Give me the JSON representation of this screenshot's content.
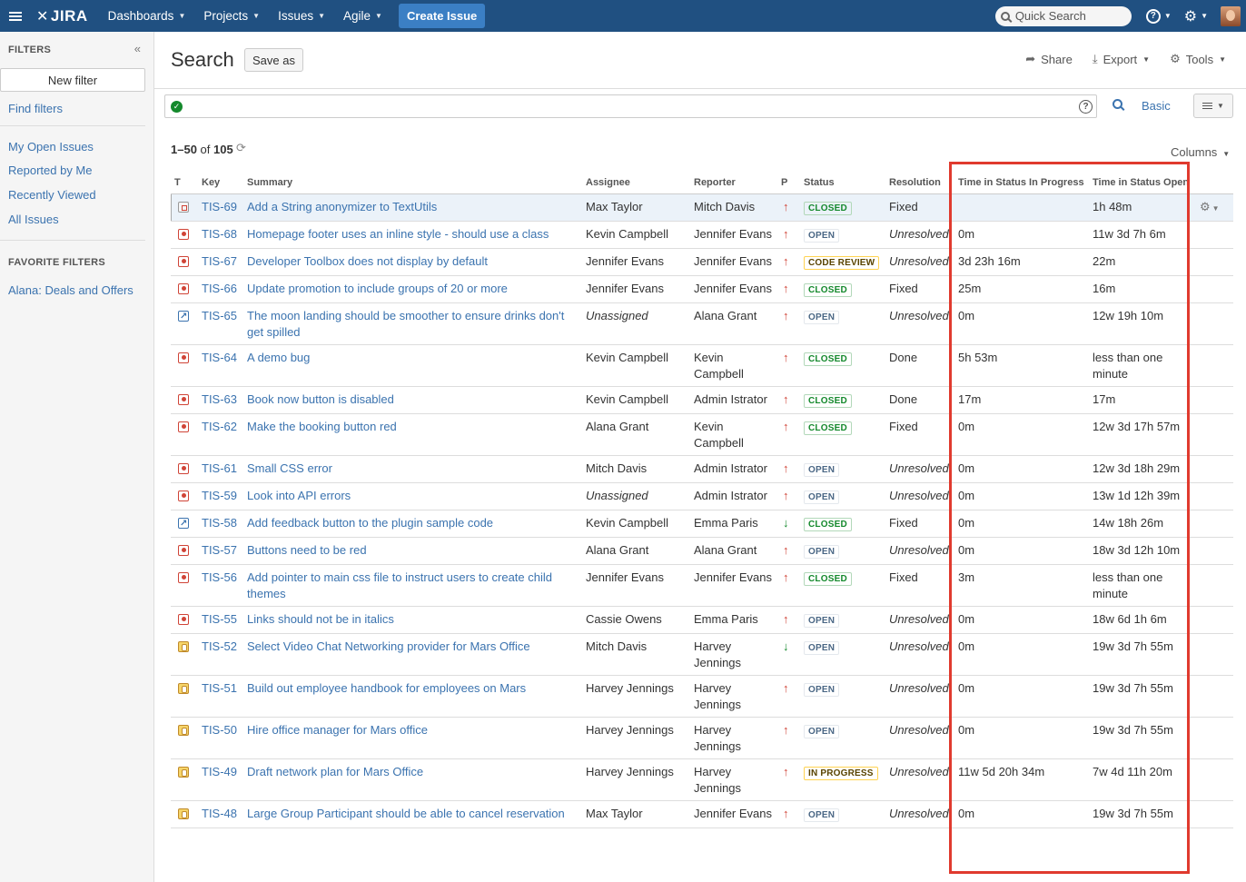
{
  "topnav": {
    "logo": "JIRA",
    "items": [
      "Dashboards",
      "Projects",
      "Issues",
      "Agile"
    ],
    "create": "Create Issue",
    "quick_search_placeholder": "Quick Search",
    "help_glyph": "?",
    "settings_glyph": "⚙"
  },
  "sidebar": {
    "header": "FILTERS",
    "collapse": "«",
    "new_filter": "New filter",
    "find_filters": "Find filters",
    "links": [
      "My Open Issues",
      "Reported by Me",
      "Recently Viewed",
      "All Issues"
    ],
    "favorite_header": "FAVORITE FILTERS",
    "favorites": [
      "Alana: Deals and Offers"
    ]
  },
  "header": {
    "title": "Search",
    "save_as": "Save as",
    "share": "Share",
    "export": "Export",
    "tools": "Tools"
  },
  "search": {
    "basic": "Basic",
    "help": "?"
  },
  "results": {
    "range": "1–50",
    "of": "of",
    "total": "105",
    "columns_label": "Columns"
  },
  "table": {
    "headers": [
      "T",
      "Key",
      "Summary",
      "Assignee",
      "Reporter",
      "P",
      "Status",
      "Resolution",
      "Time in Status In Progress",
      "Time in Status Open"
    ],
    "rows": [
      {
        "type": "sub",
        "key": "TIS-69",
        "summary": "Add a String anonymizer to TextUtils",
        "assignee": "Max Taylor",
        "reporter": "Mitch Davis",
        "priority": "up",
        "status": "CLOSED",
        "status_style": "success",
        "resolution": "Fixed",
        "in_progress": "",
        "open": "1h 48m"
      },
      {
        "type": "bug",
        "key": "TIS-68",
        "summary": "Homepage footer uses an inline style - should use a class",
        "assignee": "Kevin Campbell",
        "reporter": "Jennifer Evans",
        "priority": "up",
        "status": "OPEN",
        "status_style": "blue",
        "resolution": "Unresolved",
        "in_progress": "0m",
        "open": "11w 3d 7h 6m"
      },
      {
        "type": "bug",
        "key": "TIS-67",
        "summary": "Developer Toolbox does not display by default",
        "assignee": "Jennifer Evans",
        "reporter": "Jennifer Evans",
        "priority": "up",
        "status": "CODE REVIEW",
        "status_style": "yellow",
        "resolution": "Unresolved",
        "in_progress": "3d 23h 16m",
        "open": "22m"
      },
      {
        "type": "bug",
        "key": "TIS-66",
        "summary": "Update promotion to include groups of 20 or more",
        "assignee": "Jennifer Evans",
        "reporter": "Jennifer Evans",
        "priority": "up",
        "status": "CLOSED",
        "status_style": "success",
        "resolution": "Fixed",
        "in_progress": "25m",
        "open": "16m"
      },
      {
        "type": "imp",
        "key": "TIS-65",
        "summary": "The moon landing should be smoother to ensure drinks don't get spilled",
        "assignee": "Unassigned",
        "reporter": "Alana Grant",
        "priority": "up",
        "status": "OPEN",
        "status_style": "blue",
        "resolution": "Unresolved",
        "in_progress": "0m",
        "open": "12w 19h 10m"
      },
      {
        "type": "bug",
        "key": "TIS-64",
        "summary": "A demo bug",
        "assignee": "Kevin Campbell",
        "reporter": "Kevin Campbell",
        "priority": "up",
        "status": "CLOSED",
        "status_style": "success",
        "resolution": "Done",
        "in_progress": "5h 53m",
        "open": "less than one minute"
      },
      {
        "type": "bug",
        "key": "TIS-63",
        "summary": "Book now button is disabled",
        "assignee": "Kevin Campbell",
        "reporter": "Admin Istrator",
        "priority": "up",
        "status": "CLOSED",
        "status_style": "success",
        "resolution": "Done",
        "in_progress": "17m",
        "open": "17m"
      },
      {
        "type": "bug",
        "key": "TIS-62",
        "summary": "Make the booking button red",
        "assignee": "Alana Grant",
        "reporter": "Kevin Campbell",
        "priority": "up",
        "status": "CLOSED",
        "status_style": "success",
        "resolution": "Fixed",
        "in_progress": "0m",
        "open": "12w 3d 17h 57m"
      },
      {
        "type": "bug",
        "key": "TIS-61",
        "summary": "Small CSS error",
        "assignee": "Mitch Davis",
        "reporter": "Admin Istrator",
        "priority": "up",
        "status": "OPEN",
        "status_style": "blue",
        "resolution": "Unresolved",
        "in_progress": "0m",
        "open": "12w 3d 18h 29m"
      },
      {
        "type": "bug",
        "key": "TIS-59",
        "summary": "Look into API errors",
        "assignee": "Unassigned",
        "reporter": "Admin Istrator",
        "priority": "up",
        "status": "OPEN",
        "status_style": "blue",
        "resolution": "Unresolved",
        "in_progress": "0m",
        "open": "13w 1d 12h 39m"
      },
      {
        "type": "imp",
        "key": "TIS-58",
        "summary": "Add feedback button to the plugin sample code",
        "assignee": "Kevin Campbell",
        "reporter": "Emma Paris",
        "priority": "down",
        "status": "CLOSED",
        "status_style": "success",
        "resolution": "Fixed",
        "in_progress": "0m",
        "open": "14w 18h 26m"
      },
      {
        "type": "bug",
        "key": "TIS-57",
        "summary": "Buttons need to be red",
        "assignee": "Alana Grant",
        "reporter": "Alana Grant",
        "priority": "up",
        "status": "OPEN",
        "status_style": "blue",
        "resolution": "Unresolved",
        "in_progress": "0m",
        "open": "18w 3d 12h 10m"
      },
      {
        "type": "bug",
        "key": "TIS-56",
        "summary": "Add pointer to main css file to instruct users to create child themes",
        "assignee": "Jennifer Evans",
        "reporter": "Jennifer Evans",
        "priority": "up",
        "status": "CLOSED",
        "status_style": "success",
        "resolution": "Fixed",
        "in_progress": "3m",
        "open": "less than one minute"
      },
      {
        "type": "bug",
        "key": "TIS-55",
        "summary": "Links should not be in italics",
        "assignee": "Cassie Owens",
        "reporter": "Emma Paris",
        "priority": "up",
        "status": "OPEN",
        "status_style": "blue",
        "resolution": "Unresolved",
        "in_progress": "0m",
        "open": "18w 6d 1h 6m"
      },
      {
        "type": "task",
        "key": "TIS-52",
        "summary": "Select Video Chat Networking provider for Mars Office",
        "assignee": "Mitch Davis",
        "reporter": "Harvey Jennings",
        "priority": "down",
        "status": "OPEN",
        "status_style": "blue",
        "resolution": "Unresolved",
        "in_progress": "0m",
        "open": "19w 3d 7h 55m"
      },
      {
        "type": "task",
        "key": "TIS-51",
        "summary": "Build out employee handbook for employees on Mars",
        "assignee": "Harvey Jennings",
        "reporter": "Harvey Jennings",
        "priority": "up",
        "status": "OPEN",
        "status_style": "blue",
        "resolution": "Unresolved",
        "in_progress": "0m",
        "open": "19w 3d 7h 55m"
      },
      {
        "type": "task",
        "key": "TIS-50",
        "summary": "Hire office manager for Mars office",
        "assignee": "Harvey Jennings",
        "reporter": "Harvey Jennings",
        "priority": "up",
        "status": "OPEN",
        "status_style": "blue",
        "resolution": "Unresolved",
        "in_progress": "0m",
        "open": "19w 3d 7h 55m"
      },
      {
        "type": "task",
        "key": "TIS-49",
        "summary": "Draft network plan for Mars Office",
        "assignee": "Harvey Jennings",
        "reporter": "Harvey Jennings",
        "priority": "up",
        "status": "IN PROGRESS",
        "status_style": "yellow",
        "resolution": "Unresolved",
        "in_progress": "11w 5d 20h 34m",
        "open": "7w 4d 11h 20m"
      },
      {
        "type": "task",
        "key": "TIS-48",
        "summary": "Large Group Participant should be able to cancel reservation",
        "assignee": "Max Taylor",
        "reporter": "Jennifer Evans",
        "priority": "up",
        "status": "OPEN",
        "status_style": "blue",
        "resolution": "Unresolved",
        "in_progress": "0m",
        "open": "19w 3d 7h 55m"
      }
    ]
  },
  "colors": {
    "nav_bg": "#205081",
    "link": "#3b73af",
    "highlight": "#e03a2e"
  }
}
